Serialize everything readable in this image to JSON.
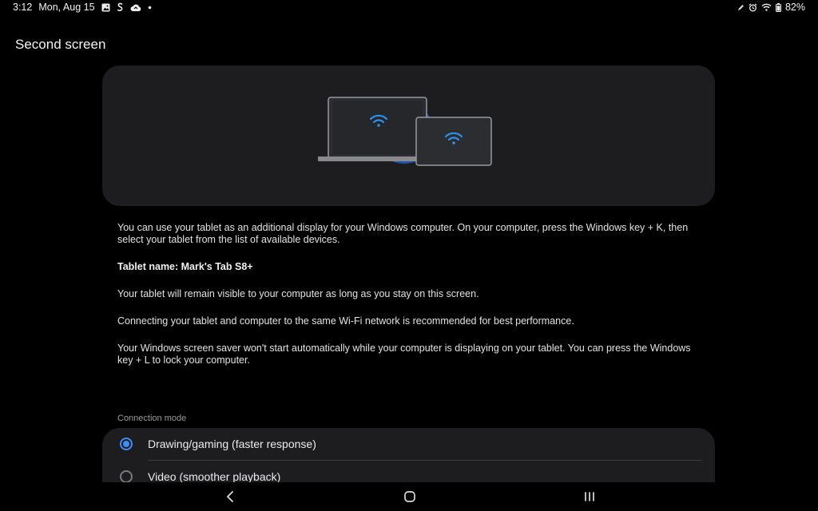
{
  "status_bar": {
    "time": "3:12",
    "date": "Mon, Aug 15",
    "battery": "82%",
    "icons_left": [
      "gallery-icon",
      "s-pen-notification-icon",
      "cloud-sync-icon",
      "dot-icon"
    ],
    "icons_right": [
      "pen-icon",
      "alarm-icon",
      "wifi-icon",
      "battery-icon"
    ]
  },
  "header": {
    "title": "Second screen"
  },
  "illustration": {
    "name": "laptop-and-tablet-wifi",
    "accent_color": "#2d8ff0"
  },
  "description": {
    "intro": "You can use your tablet as an additional display for your Windows computer. On your computer, press the Windows key + K, then select your tablet from the list of available devices.",
    "tablet_name": "Tablet name: Mark's Tab S8+",
    "visibility": "Your tablet will remain visible to your computer as long as you stay on this screen.",
    "wifi_tip": "Connecting your tablet and computer to the same Wi-Fi network is recommended for best performance.",
    "screensaver": "Your Windows screen saver won't start automatically while your computer is displaying on your tablet. You can press the Windows key + L to lock your computer."
  },
  "connection_mode": {
    "label": "Connection mode",
    "options": [
      {
        "label": "Drawing/gaming (faster response)",
        "selected": true
      },
      {
        "label": "Video (smoother playback)",
        "selected": false
      }
    ]
  },
  "nav_bar": {
    "buttons": [
      "back-icon",
      "home-icon",
      "recents-icon"
    ]
  },
  "colors": {
    "background": "#000000",
    "card": "#1d1d1f",
    "accent": "#3e8df5"
  }
}
